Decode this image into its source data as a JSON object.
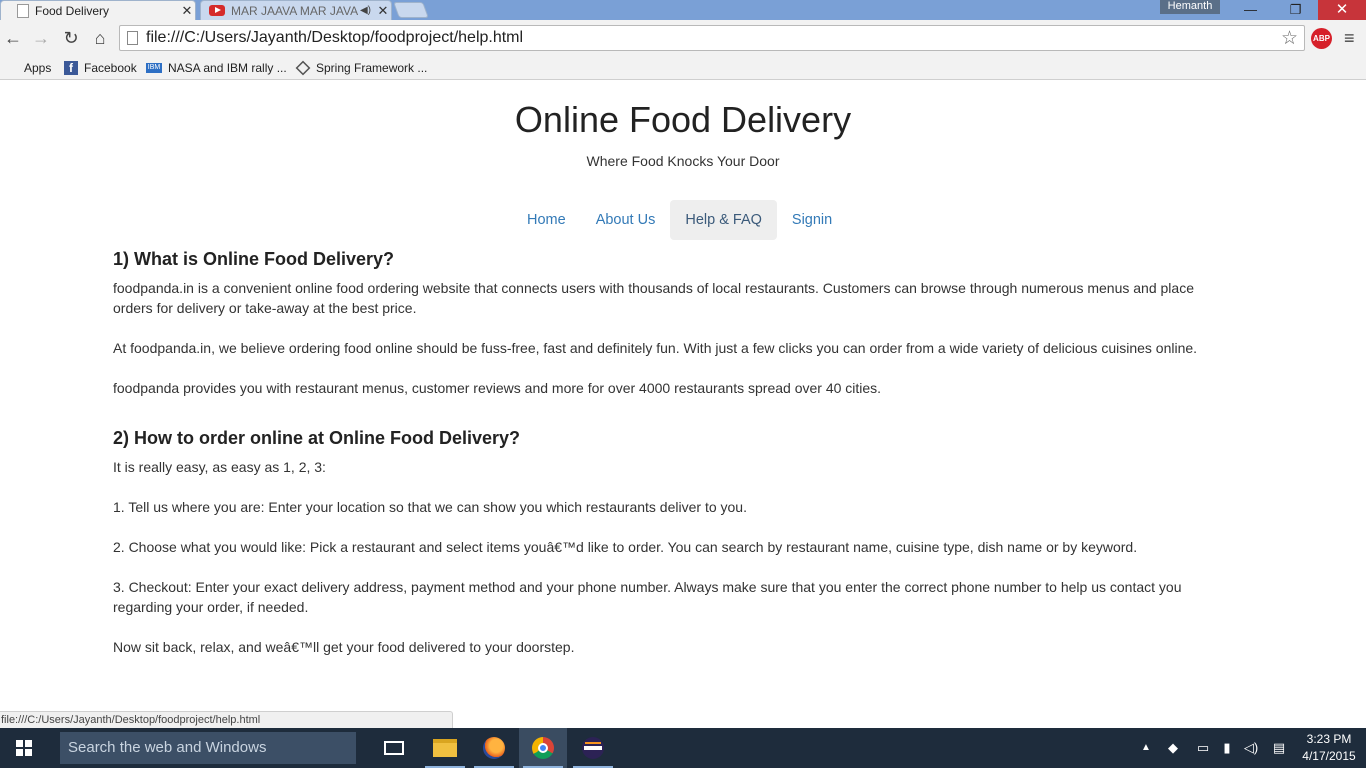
{
  "browser": {
    "tabs": [
      {
        "title": "Food Delivery",
        "active": true
      },
      {
        "title": "MAR JAAVA MAR JAVA",
        "active": false,
        "audio_icon": "speaker-icon"
      }
    ],
    "profile_name": "Hemanth",
    "url": "file:///C:/Users/Jayanth/Desktop/foodproject/help.html",
    "abp_label": "ABP",
    "bookmarks": [
      {
        "label": "Apps",
        "icon": "apps-icon"
      },
      {
        "label": "Facebook",
        "icon": "facebook-icon"
      },
      {
        "label": "NASA and IBM rally ...",
        "icon": "nasa-icon"
      },
      {
        "label": "Spring Framework ...",
        "icon": "spring-icon"
      }
    ],
    "status_url": "file:///C:/Users/Jayanth/Desktop/foodproject/help.html"
  },
  "site": {
    "title": "Online Food Delivery",
    "tagline": "Where Food Knocks Your Door",
    "nav": [
      {
        "label": "Home",
        "active": false
      },
      {
        "label": "About Us",
        "active": false
      },
      {
        "label": "Help & FAQ",
        "active": true
      },
      {
        "label": "Signin",
        "active": false
      }
    ]
  },
  "faq": {
    "q1": {
      "heading": "1) What is Online Food Delivery?",
      "paragraphs": [
        "foodpanda.in is a convenient online food ordering website that connects users with thousands of local restaurants. Customers can browse through numerous menus and place orders for delivery or take-away at the best price.",
        "At foodpanda.in, we believe ordering food online should be fuss-free, fast and definitely fun. With just a few clicks you can order from a wide variety of delicious cuisines online.",
        "foodpanda provides you with restaurant menus, customer reviews and more for over 4000 restaurants spread over 40 cities."
      ]
    },
    "q2": {
      "heading": "2) How to order online at Online Food Delivery?",
      "paragraphs": [
        "It is really easy, as easy as 1, 2, 3:",
        "1. Tell us where you are: Enter your location so that we can show you which restaurants deliver to you.",
        "2. Choose what you would like: Pick a restaurant and select items youâ€™d like to order. You can search by restaurant name, cuisine type, dish name or by keyword.",
        "3. Checkout: Enter your exact delivery address, payment method and your phone number. Always make sure that you enter the correct phone number to help us contact you regarding your order, if needed.",
        "Now sit back, relax, and weâ€™ll get your food delivered to your doorstep."
      ]
    }
  },
  "taskbar": {
    "search_placeholder": "Search the web and Windows",
    "apps": [
      "task-view-icon",
      "file-explorer-icon",
      "firefox-icon",
      "chrome-icon",
      "eclipse-icon"
    ],
    "clock_time": "3:23 PM",
    "clock_date": "4/17/2015"
  },
  "colors": {
    "link": "#337ab7",
    "active_pill": "#eeeeee",
    "taskbar": "#1e2c3c",
    "titlebar": "#7aa0d6",
    "close_button": "#c7343a"
  }
}
